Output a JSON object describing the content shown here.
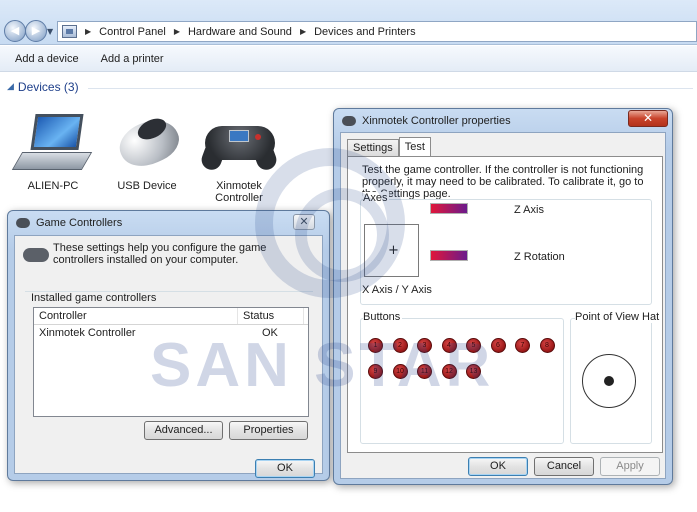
{
  "explorer": {
    "breadcrumb": [
      "Control Panel",
      "Hardware and Sound",
      "Devices and Printers"
    ],
    "toolbar": [
      "Add a device",
      "Add a printer"
    ],
    "section_title": "Devices (3)",
    "devices": [
      {
        "label_line1": "ALIEN-PC",
        "label_line2": "",
        "icon": "laptop-icon"
      },
      {
        "label_line1": "USB Device",
        "label_line2": "",
        "icon": "mouse-icon"
      },
      {
        "label_line1": "Xinmotek",
        "label_line2": "Controller",
        "icon": "gamepad-icon"
      }
    ]
  },
  "game_controllers": {
    "title": "Game Controllers",
    "intro": "These settings help you configure the game controllers installed on your computer.",
    "group_label": "Installed game controllers",
    "columns": [
      "Controller",
      "Status"
    ],
    "rows": [
      {
        "controller": "Xinmotek Controller",
        "status": "OK"
      }
    ],
    "advanced_label": "Advanced...",
    "properties_label": "Properties",
    "ok_label": "OK"
  },
  "properties": {
    "title": "Xinmotek Controller properties",
    "tabs": [
      "Settings",
      "Test"
    ],
    "active_tab": "Test",
    "instructions": "Test the game controller.  If the controller is not functioning properly, it may need to be calibrated.  To calibrate it, go to the Settings page.",
    "axes_label": "Axes",
    "xy_label": "X Axis / Y Axis",
    "z_axis_label": "Z Axis",
    "z_rotation_label": "Z Rotation",
    "buttons_label": "Buttons",
    "button_numbers": [
      "1",
      "2",
      "3",
      "4",
      "5",
      "6",
      "7",
      "8",
      "9",
      "10",
      "11",
      "12",
      "13"
    ],
    "pov_label": "Point of View Hat",
    "ok_label": "OK",
    "cancel_label": "Cancel",
    "apply_label": "Apply"
  },
  "watermark": "SAN STAR",
  "colors": {
    "axis_bar_start": "#e0173a",
    "axis_bar_end": "#6b1a8c",
    "button_red": "#b21e1e",
    "title_blue": "#1e3f8a"
  }
}
